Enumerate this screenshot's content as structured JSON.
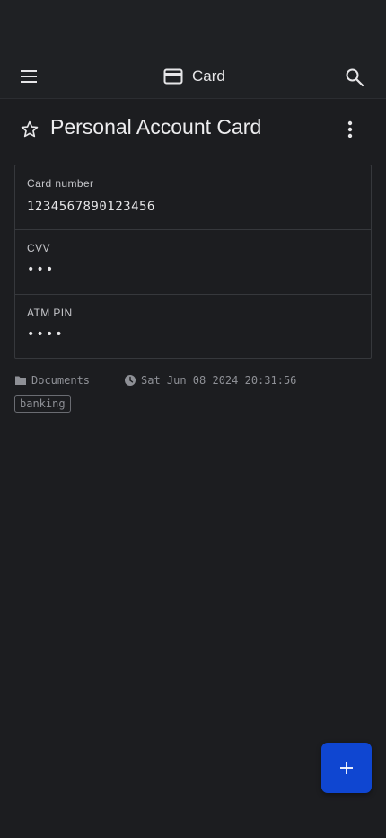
{
  "appbar": {
    "title": "Card",
    "icons": {
      "menu": "menu-icon",
      "type": "credit-card-icon",
      "search": "search-icon"
    }
  },
  "item": {
    "title": "Personal Account Card",
    "favorite_icon": "star-outline-icon",
    "more_icon": "more-vert-icon"
  },
  "fields": [
    {
      "label": "Card number",
      "value": "1234567890123456"
    },
    {
      "label": "CVV",
      "value": "•••"
    },
    {
      "label": "ATM PIN",
      "value": "••••"
    }
  ],
  "meta": {
    "folder": "Documents",
    "folder_icon": "folder-icon",
    "timestamp": "Sat Jun 08 2024 20:31:56",
    "time_icon": "clock-icon"
  },
  "tags": [
    "banking"
  ],
  "fab": {
    "icon": "add-icon"
  },
  "colors": {
    "background": "#1c1d20",
    "appbar": "#1f2124",
    "fab": "#0f46d1",
    "muted_text": "#8e9096"
  }
}
